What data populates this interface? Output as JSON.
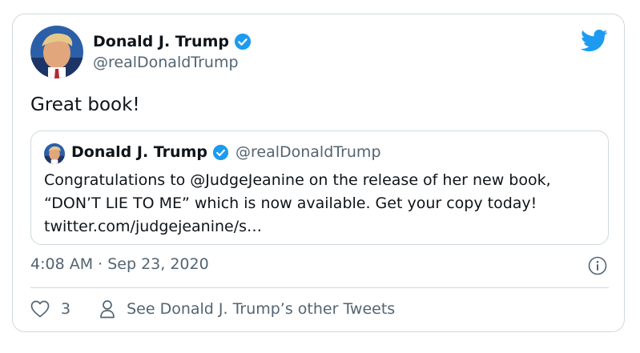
{
  "author": {
    "name": "Donald J. Trump",
    "handle": "@realDonaldTrump",
    "verified": true
  },
  "tweet": {
    "text": "Great book!",
    "timestamp": "4:08 AM · Sep 23, 2020"
  },
  "quote": {
    "name": "Donald J. Trump",
    "handle": "@realDonaldTrump",
    "verified": true,
    "text": "Congratulations to @JudgeJeanine on the release of her new book, “DON’T LIE TO ME” which is now available. Get your copy today! twitter.com/judgejeanine/s…"
  },
  "actions": {
    "like_count": "3",
    "other_tweets_label": "See Donald J. Trump’s other Tweets"
  },
  "icons": {
    "brand": "twitter-bird-icon",
    "verified": "verified-badge-icon",
    "info": "info-icon",
    "like": "heart-icon",
    "profile": "person-icon"
  },
  "colors": {
    "twitter_blue": "#1d9bf0",
    "text_primary": "#0f1419",
    "text_secondary": "#536471",
    "border": "#cfd9de"
  }
}
